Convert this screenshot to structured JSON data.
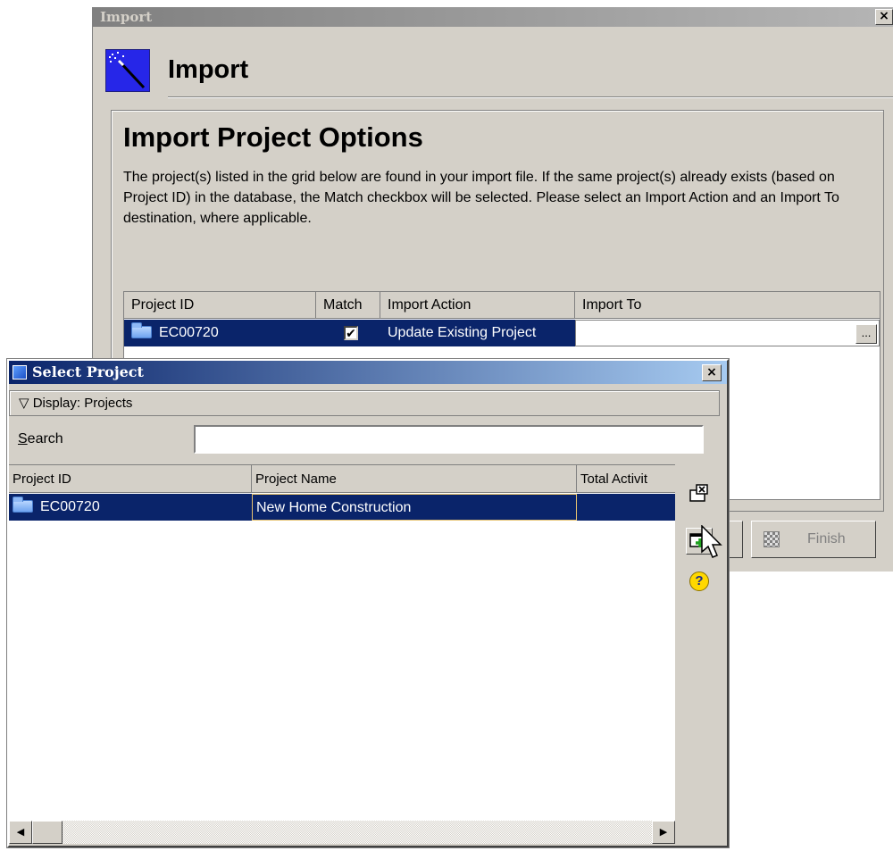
{
  "import_window": {
    "title": "Import",
    "close_glyph": "×",
    "heading": "Import",
    "section_title": "Import Project Options",
    "description": "The project(s) listed in the grid below are found in your import file. If the same project(s) already exists (based on Project ID) in the database, the Match checkbox will be selected.  Please select an Import Action and an Import To destination, where applicable.",
    "grid": {
      "columns": [
        "Project ID",
        "Match",
        "Import Action",
        "Import To"
      ],
      "rows": [
        {
          "project_id": "EC00720",
          "match": true,
          "match_glyph": "✔",
          "import_action": "Update Existing Project",
          "import_to": ""
        }
      ],
      "ellipsis_label": "..."
    },
    "finish_label": "Finish"
  },
  "select_dialog": {
    "title": "Select Project",
    "close_glyph": "×",
    "display_label": "Display: Projects",
    "display_chevron": "▽",
    "search_label_accel": "S",
    "search_label_rest": "earch",
    "search_value": "",
    "columns": [
      "Project ID",
      "Project Name",
      "Total Activit"
    ],
    "rows": [
      {
        "project_id": "EC00720",
        "project_name": "New Home Construction",
        "total_activities": ""
      }
    ],
    "scroll_left_glyph": "◀",
    "scroll_right_glyph": "▶",
    "help_glyph": "?"
  }
}
